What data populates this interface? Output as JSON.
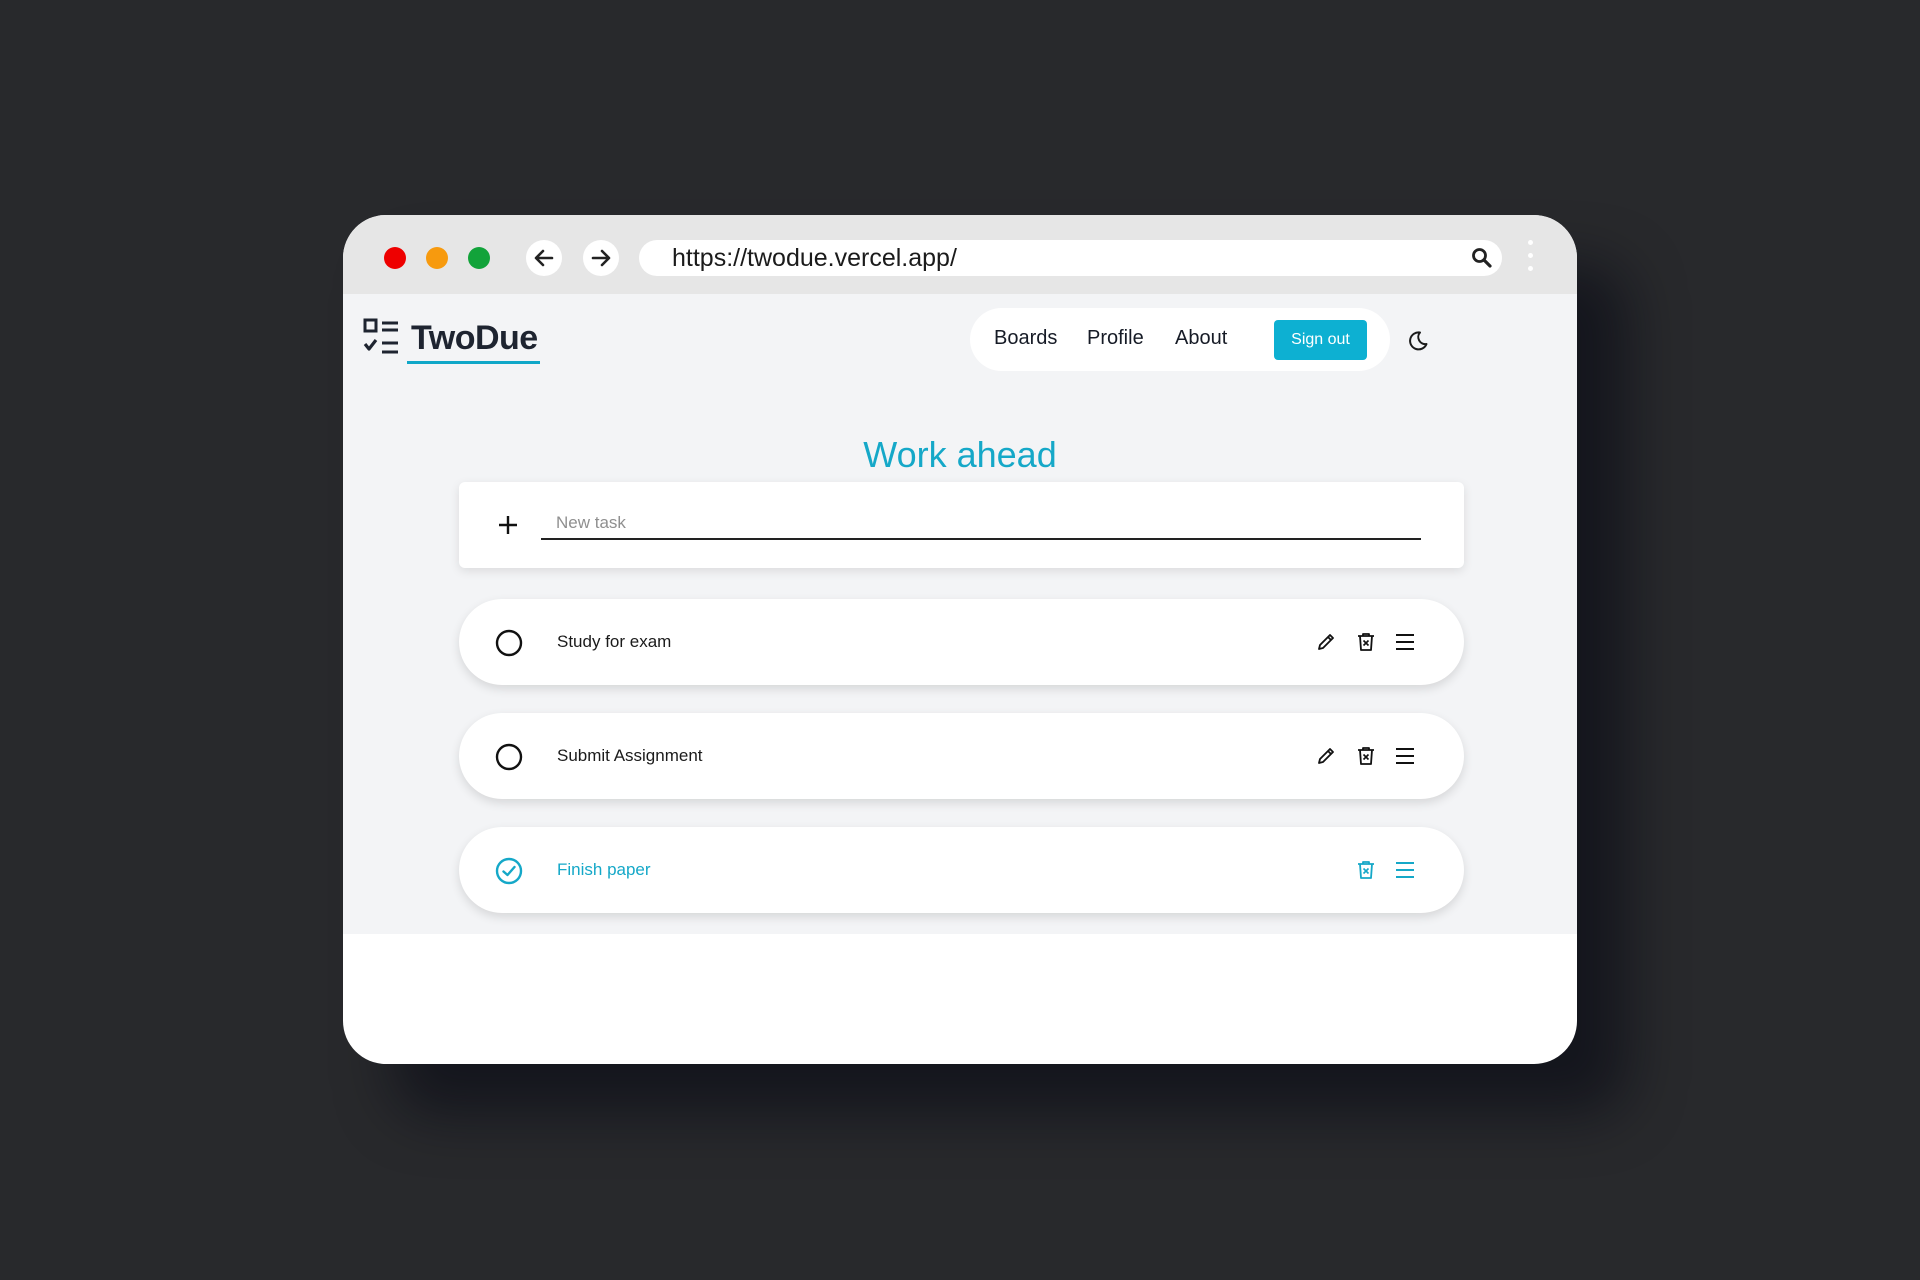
{
  "browser": {
    "url": "https://twodue.vercel.app/"
  },
  "app": {
    "brand": "TwoDue",
    "nav": {
      "boards": "Boards",
      "profile": "Profile",
      "about": "About",
      "sign_out": "Sign out"
    },
    "theme_icon": "moon-icon"
  },
  "board": {
    "title": "Work ahead",
    "new_task_placeholder": "New task",
    "tasks": [
      {
        "label": "Study for exam",
        "done": false
      },
      {
        "label": "Submit Assignment",
        "done": false
      },
      {
        "label": "Finish paper",
        "done": true
      }
    ]
  },
  "colors": {
    "accent": "#0db0d2",
    "accent_text": "#15a8c8",
    "backdrop": "#28292c"
  }
}
